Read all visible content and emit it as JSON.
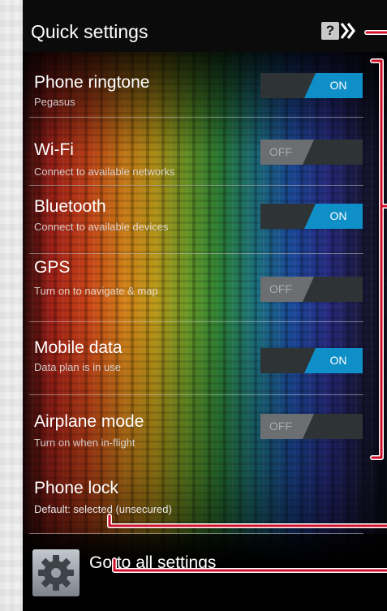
{
  "header": {
    "title": "Quick settings",
    "help_glyph": "?"
  },
  "settings": [
    {
      "id": "phone-ringtone",
      "title": "Phone ringtone",
      "subtitle": "Pegasus",
      "toggle": "ON"
    },
    {
      "id": "wifi",
      "title": "Wi-Fi",
      "subtitle": "Connect to available networks",
      "toggle": "OFF"
    },
    {
      "id": "bluetooth",
      "title": "Bluetooth",
      "subtitle": "Connect to available devices",
      "toggle": "ON"
    },
    {
      "id": "gps",
      "title": "GPS",
      "subtitle": "Turn on to navigate & map",
      "toggle": "OFF"
    },
    {
      "id": "mobile-data",
      "title": "Mobile data",
      "subtitle": "Data plan is in use",
      "toggle": "ON"
    },
    {
      "id": "airplane-mode",
      "title": "Airplane mode",
      "subtitle": "Turn on when in-flight",
      "toggle": "OFF"
    }
  ],
  "phone_lock": {
    "title": "Phone lock",
    "subtitle": "Default: selected (unsecured)"
  },
  "footer": {
    "all_settings_label": "Go to all settings",
    "icon": "gear-icon"
  },
  "colors": {
    "toggle_on": "#0f8fc8",
    "toggle_off": "#6c6f72",
    "callout": "#d0102a",
    "topbar": "#0b0b0b"
  }
}
